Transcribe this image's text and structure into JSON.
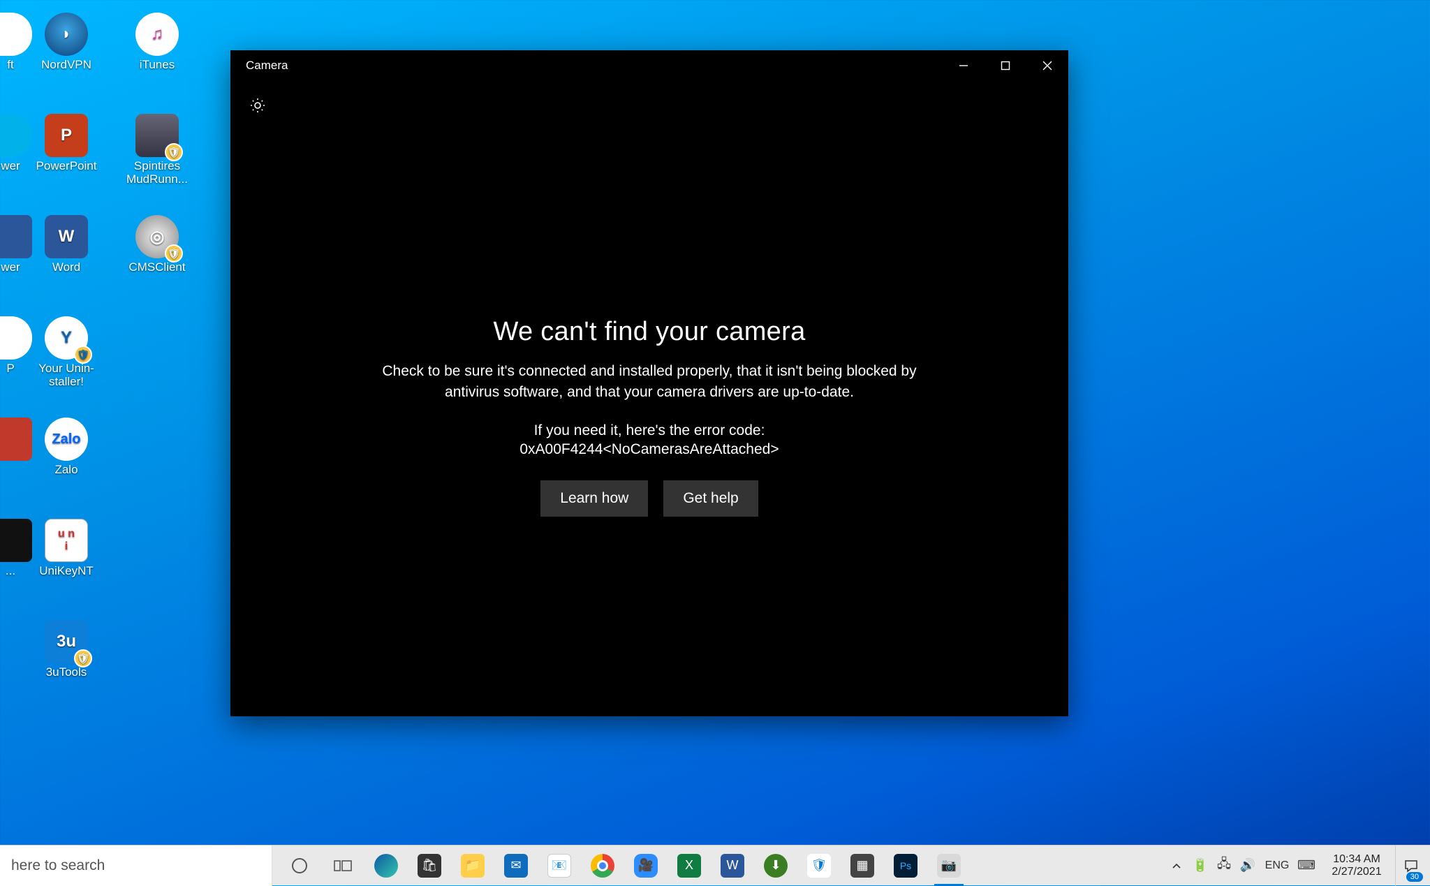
{
  "desktop_icons": {
    "col0_partial": [
      {
        "label": "ft"
      },
      {
        "label": "wer"
      },
      {
        "label": "wer"
      },
      {
        "label": "P"
      },
      {
        "label": ""
      },
      {
        "label": "..."
      }
    ],
    "row0": [
      {
        "label": "NordVPN"
      },
      {
        "label": "iTunes"
      }
    ],
    "row1": [
      {
        "label": "PowerPoint"
      },
      {
        "label": "Spintires MudRunn..."
      }
    ],
    "row2": [
      {
        "label": "Word"
      },
      {
        "label": "CMSClient"
      }
    ],
    "row3": [
      {
        "label": "Your Unin-staller!"
      }
    ],
    "row4": [
      {
        "label": "Zalo"
      }
    ],
    "row5": [
      {
        "label": "UniKeyNT"
      }
    ],
    "row6": [
      {
        "label": "3uTools"
      }
    ]
  },
  "window": {
    "title": "Camera",
    "error_title": "We can't find your camera",
    "error_body": "Check to be sure it's connected and installed properly, that it isn't being blocked by antivirus software, and that your camera drivers are up-to-date.",
    "error_code_intro": "If you need it, here's the error code:",
    "error_code": "0xA00F4244<NoCamerasAreAttached>",
    "btn_learn": "Learn how",
    "btn_help": "Get help"
  },
  "taskbar": {
    "search_placeholder": "here to search",
    "tray_lang": "ENG",
    "clock_time": "10:34 AM",
    "clock_date": "2/27/2021",
    "notif_count": "30"
  }
}
